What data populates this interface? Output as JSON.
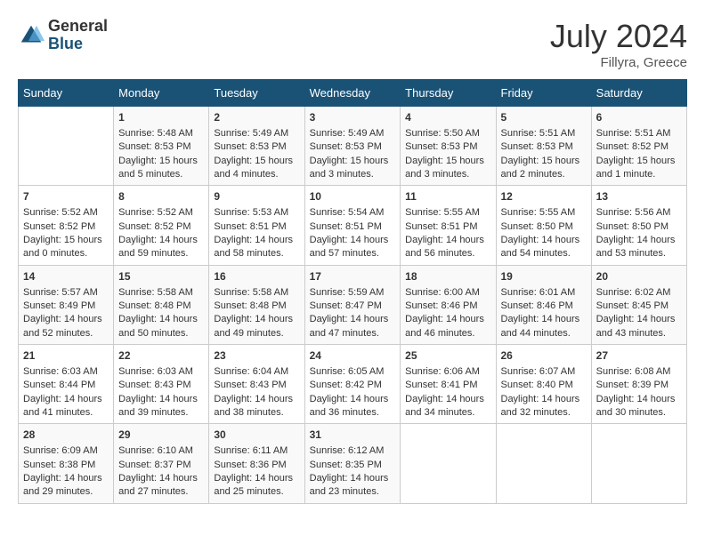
{
  "header": {
    "logo_general": "General",
    "logo_blue": "Blue",
    "month_year": "July 2024",
    "location": "Fillyra, Greece"
  },
  "days_of_week": [
    "Sunday",
    "Monday",
    "Tuesday",
    "Wednesday",
    "Thursday",
    "Friday",
    "Saturday"
  ],
  "weeks": [
    [
      {
        "day": "",
        "sunrise": "",
        "sunset": "",
        "daylight": ""
      },
      {
        "day": "1",
        "sunrise": "Sunrise: 5:48 AM",
        "sunset": "Sunset: 8:53 PM",
        "daylight": "Daylight: 15 hours and 5 minutes."
      },
      {
        "day": "2",
        "sunrise": "Sunrise: 5:49 AM",
        "sunset": "Sunset: 8:53 PM",
        "daylight": "Daylight: 15 hours and 4 minutes."
      },
      {
        "day": "3",
        "sunrise": "Sunrise: 5:49 AM",
        "sunset": "Sunset: 8:53 PM",
        "daylight": "Daylight: 15 hours and 3 minutes."
      },
      {
        "day": "4",
        "sunrise": "Sunrise: 5:50 AM",
        "sunset": "Sunset: 8:53 PM",
        "daylight": "Daylight: 15 hours and 3 minutes."
      },
      {
        "day": "5",
        "sunrise": "Sunrise: 5:51 AM",
        "sunset": "Sunset: 8:53 PM",
        "daylight": "Daylight: 15 hours and 2 minutes."
      },
      {
        "day": "6",
        "sunrise": "Sunrise: 5:51 AM",
        "sunset": "Sunset: 8:52 PM",
        "daylight": "Daylight: 15 hours and 1 minute."
      }
    ],
    [
      {
        "day": "7",
        "sunrise": "Sunrise: 5:52 AM",
        "sunset": "Sunset: 8:52 PM",
        "daylight": "Daylight: 15 hours and 0 minutes."
      },
      {
        "day": "8",
        "sunrise": "Sunrise: 5:52 AM",
        "sunset": "Sunset: 8:52 PM",
        "daylight": "Daylight: 14 hours and 59 minutes."
      },
      {
        "day": "9",
        "sunrise": "Sunrise: 5:53 AM",
        "sunset": "Sunset: 8:51 PM",
        "daylight": "Daylight: 14 hours and 58 minutes."
      },
      {
        "day": "10",
        "sunrise": "Sunrise: 5:54 AM",
        "sunset": "Sunset: 8:51 PM",
        "daylight": "Daylight: 14 hours and 57 minutes."
      },
      {
        "day": "11",
        "sunrise": "Sunrise: 5:55 AM",
        "sunset": "Sunset: 8:51 PM",
        "daylight": "Daylight: 14 hours and 56 minutes."
      },
      {
        "day": "12",
        "sunrise": "Sunrise: 5:55 AM",
        "sunset": "Sunset: 8:50 PM",
        "daylight": "Daylight: 14 hours and 54 minutes."
      },
      {
        "day": "13",
        "sunrise": "Sunrise: 5:56 AM",
        "sunset": "Sunset: 8:50 PM",
        "daylight": "Daylight: 14 hours and 53 minutes."
      }
    ],
    [
      {
        "day": "14",
        "sunrise": "Sunrise: 5:57 AM",
        "sunset": "Sunset: 8:49 PM",
        "daylight": "Daylight: 14 hours and 52 minutes."
      },
      {
        "day": "15",
        "sunrise": "Sunrise: 5:58 AM",
        "sunset": "Sunset: 8:48 PM",
        "daylight": "Daylight: 14 hours and 50 minutes."
      },
      {
        "day": "16",
        "sunrise": "Sunrise: 5:58 AM",
        "sunset": "Sunset: 8:48 PM",
        "daylight": "Daylight: 14 hours and 49 minutes."
      },
      {
        "day": "17",
        "sunrise": "Sunrise: 5:59 AM",
        "sunset": "Sunset: 8:47 PM",
        "daylight": "Daylight: 14 hours and 47 minutes."
      },
      {
        "day": "18",
        "sunrise": "Sunrise: 6:00 AM",
        "sunset": "Sunset: 8:46 PM",
        "daylight": "Daylight: 14 hours and 46 minutes."
      },
      {
        "day": "19",
        "sunrise": "Sunrise: 6:01 AM",
        "sunset": "Sunset: 8:46 PM",
        "daylight": "Daylight: 14 hours and 44 minutes."
      },
      {
        "day": "20",
        "sunrise": "Sunrise: 6:02 AM",
        "sunset": "Sunset: 8:45 PM",
        "daylight": "Daylight: 14 hours and 43 minutes."
      }
    ],
    [
      {
        "day": "21",
        "sunrise": "Sunrise: 6:03 AM",
        "sunset": "Sunset: 8:44 PM",
        "daylight": "Daylight: 14 hours and 41 minutes."
      },
      {
        "day": "22",
        "sunrise": "Sunrise: 6:03 AM",
        "sunset": "Sunset: 8:43 PM",
        "daylight": "Daylight: 14 hours and 39 minutes."
      },
      {
        "day": "23",
        "sunrise": "Sunrise: 6:04 AM",
        "sunset": "Sunset: 8:43 PM",
        "daylight": "Daylight: 14 hours and 38 minutes."
      },
      {
        "day": "24",
        "sunrise": "Sunrise: 6:05 AM",
        "sunset": "Sunset: 8:42 PM",
        "daylight": "Daylight: 14 hours and 36 minutes."
      },
      {
        "day": "25",
        "sunrise": "Sunrise: 6:06 AM",
        "sunset": "Sunset: 8:41 PM",
        "daylight": "Daylight: 14 hours and 34 minutes."
      },
      {
        "day": "26",
        "sunrise": "Sunrise: 6:07 AM",
        "sunset": "Sunset: 8:40 PM",
        "daylight": "Daylight: 14 hours and 32 minutes."
      },
      {
        "day": "27",
        "sunrise": "Sunrise: 6:08 AM",
        "sunset": "Sunset: 8:39 PM",
        "daylight": "Daylight: 14 hours and 30 minutes."
      }
    ],
    [
      {
        "day": "28",
        "sunrise": "Sunrise: 6:09 AM",
        "sunset": "Sunset: 8:38 PM",
        "daylight": "Daylight: 14 hours and 29 minutes."
      },
      {
        "day": "29",
        "sunrise": "Sunrise: 6:10 AM",
        "sunset": "Sunset: 8:37 PM",
        "daylight": "Daylight: 14 hours and 27 minutes."
      },
      {
        "day": "30",
        "sunrise": "Sunrise: 6:11 AM",
        "sunset": "Sunset: 8:36 PM",
        "daylight": "Daylight: 14 hours and 25 minutes."
      },
      {
        "day": "31",
        "sunrise": "Sunrise: 6:12 AM",
        "sunset": "Sunset: 8:35 PM",
        "daylight": "Daylight: 14 hours and 23 minutes."
      },
      {
        "day": "",
        "sunrise": "",
        "sunset": "",
        "daylight": ""
      },
      {
        "day": "",
        "sunrise": "",
        "sunset": "",
        "daylight": ""
      },
      {
        "day": "",
        "sunrise": "",
        "sunset": "",
        "daylight": ""
      }
    ]
  ]
}
